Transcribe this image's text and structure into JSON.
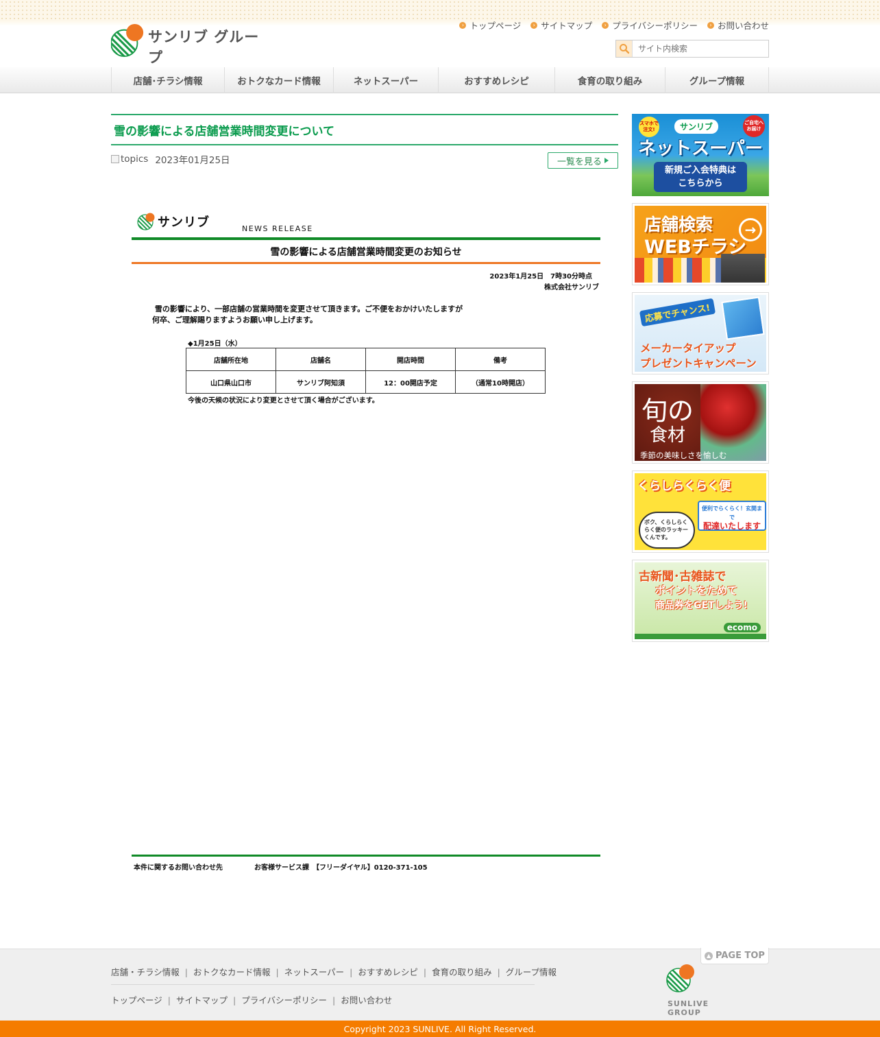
{
  "brand": {
    "logo_text": "サンリブ グループ",
    "colors": {
      "green": "#0a9b4d",
      "orange": "#ee7622",
      "footer_orange": "#f57c00"
    }
  },
  "header": {
    "top_links": [
      "トップページ",
      "サイトマップ",
      "プライバシーポリシー",
      "お問い合わせ"
    ],
    "search_placeholder": "サイト内検索"
  },
  "nav": {
    "items": [
      "店舗･チラシ情報",
      "おトクなカード情報",
      "ネットスーパー",
      "おすすめレシピ",
      "食育の取り組み",
      "グループ情報"
    ]
  },
  "article": {
    "title": "雪の影響による店舗営業時間変更について",
    "image_alt": "topics",
    "date": "2023年01月25日",
    "list_button": "一覧を見る"
  },
  "release": {
    "logo_text": "サンリブ",
    "label": "NEWS RELEASE",
    "title": "雪の影響による店舗営業時間変更のお知らせ",
    "date_time": "2023年1月25日　7時30分時点",
    "company": "株式会社サンリブ",
    "body": " 雪の影響により、一部店舗の営業時間を変更させて頂きます。ご不便をおかけいたしますが\n何卒、ご理解賜りますようお願い申し上げます。",
    "day_heading": "◆1月25日（水）",
    "table_headers": [
      "店舗所在地",
      "店舗名",
      "開店時間",
      "備考"
    ],
    "table_rows": [
      [
        "山口県山口市",
        "サンリブ阿知須",
        "12：00開店予定",
        "（通常10時開店）"
      ]
    ],
    "note": "今後の天候の状況により変更とさせて頂く場合がございます。",
    "contact_label": "本件に関するお問い合わせ先",
    "contact_value": "お客様サービス課　【フリーダイヤル】0120-371-105"
  },
  "sidebar": {
    "net_super": {
      "badge_left": "スマホで注文!",
      "brand": "サンリブ",
      "badge_right": "ご自宅へお届け",
      "title": "ネットスーパー",
      "cta_line1": "新規ご入会特典は",
      "cta_line2": "こちらから"
    },
    "store_search": {
      "line1": "店舗検索",
      "line2": "WEBチラシ"
    },
    "campaign": {
      "badge": "応募でチャンス!",
      "line1": "メーカータイアップ",
      "line2": "プレゼントキャンペーン"
    },
    "seasonal": {
      "title1": "旬の",
      "title2": "食材",
      "caption": "季節の美味しさを愉しむ"
    },
    "delivery": {
      "title": "くらしらくらく便",
      "bubble": "ボク、くらしらくらく便のラッキーくんです。",
      "tag": "便利でらくらく！玄関まで",
      "tag2": "配達いたします"
    },
    "recycle": {
      "line1": "古新聞･古雑誌で",
      "line2": "ポイントをためて",
      "line3": "商品券をGETしよう!",
      "brand": "ecomo"
    }
  },
  "footer": {
    "nav1": [
      "店舗・チラシ情報",
      "おトクなカード情報",
      "ネットスーパー",
      "おすすめレシピ",
      "食育の取り組み",
      "グループ情報"
    ],
    "nav2": [
      "トップページ",
      "サイトマップ",
      "プライバシーポリシー",
      "お問い合わせ"
    ],
    "page_top": "PAGE TOP",
    "group_logo_text": "SUNLIVE GROUP",
    "copyright": "Copyright 2023 SUNLIVE. All Right Reserved."
  }
}
